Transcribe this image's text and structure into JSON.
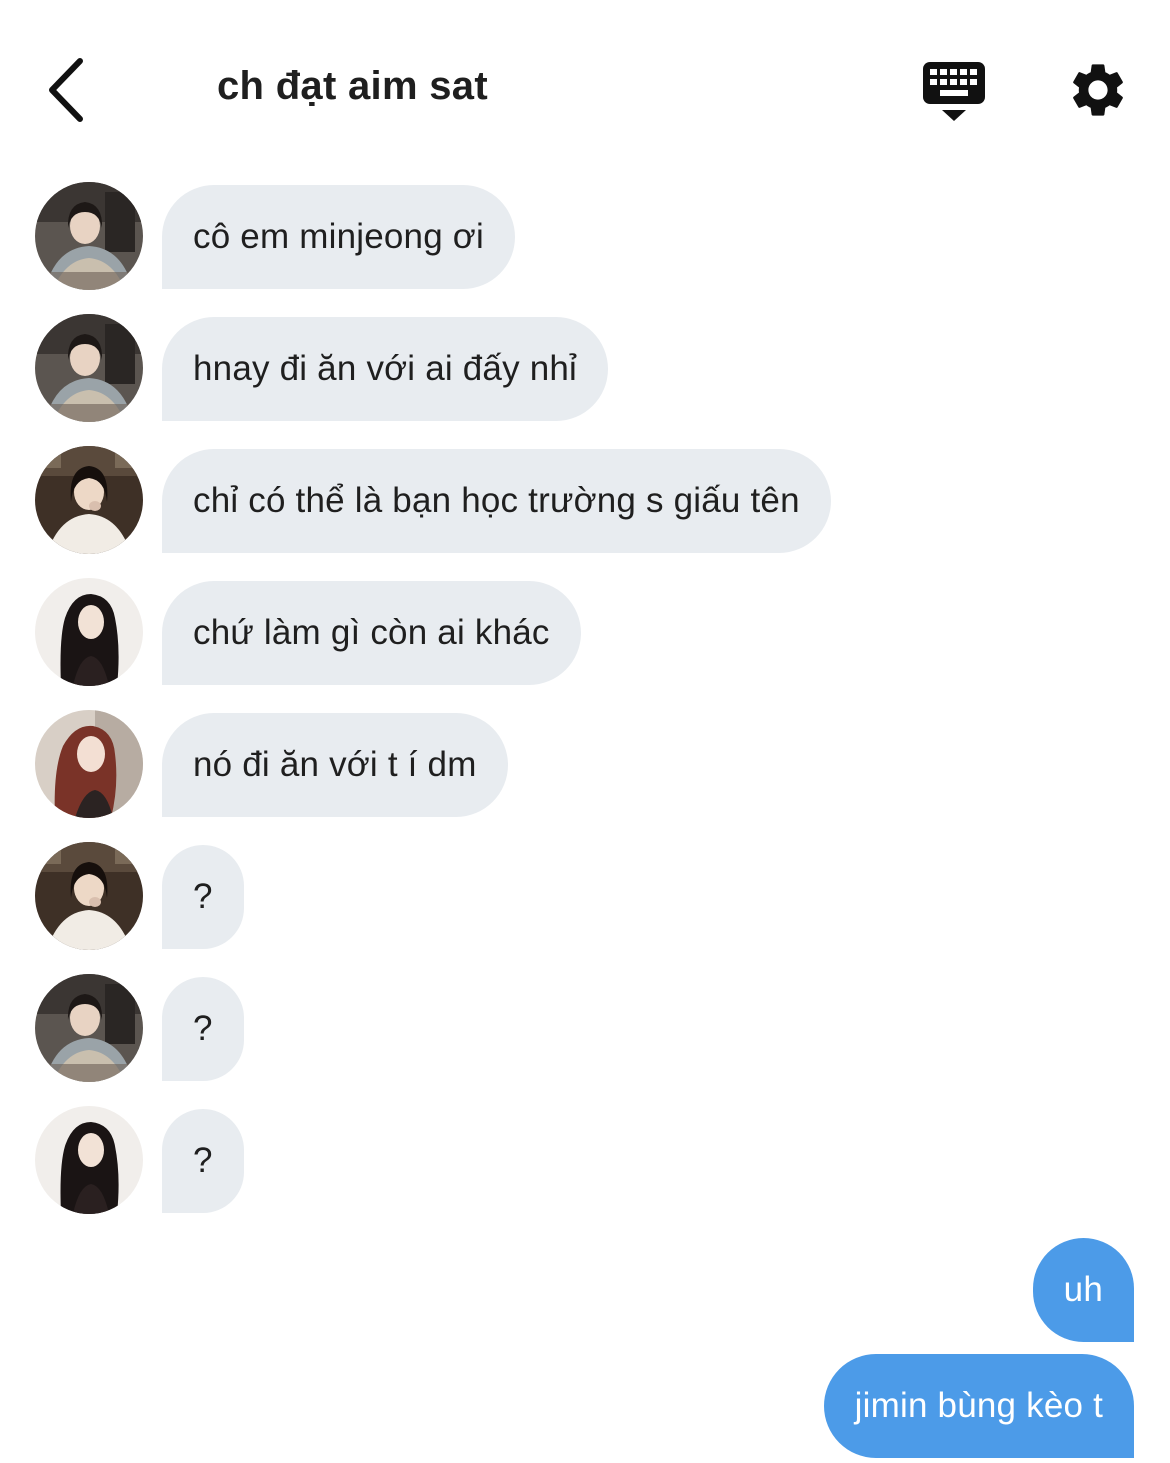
{
  "header": {
    "title": "ch đạt aim sat",
    "back_icon": "chevron-left-icon",
    "keyboard_icon": "keyboard-hide-icon",
    "settings_icon": "gear-icon"
  },
  "messages": [
    {
      "text": "cô em minjeong ơi",
      "sender": "incoming",
      "avatar": "avatar-a"
    },
    {
      "text": "hnay đi ăn với ai đấy nhỉ",
      "sender": "incoming",
      "avatar": "avatar-a"
    },
    {
      "text": "chỉ có thể là bạn học trường s giấu tên",
      "sender": "incoming",
      "avatar": "avatar-b"
    },
    {
      "text": "chứ làm gì còn ai khác",
      "sender": "incoming",
      "avatar": "avatar-c"
    },
    {
      "text": "nó đi ăn với t í dm",
      "sender": "incoming",
      "avatar": "avatar-d"
    },
    {
      "text": "?",
      "sender": "incoming",
      "avatar": "avatar-b"
    },
    {
      "text": "?",
      "sender": "incoming",
      "avatar": "avatar-a"
    },
    {
      "text": "?",
      "sender": "incoming",
      "avatar": "avatar-c"
    },
    {
      "text": "uh",
      "sender": "outgoing"
    },
    {
      "text": "jimin bùng kèo t",
      "sender": "outgoing"
    }
  ],
  "colors": {
    "incoming_bubble": "#e8ecf0",
    "outgoing_bubble": "#4c9be8",
    "outgoing_text": "#ffffff",
    "text": "#1f1f1f"
  }
}
